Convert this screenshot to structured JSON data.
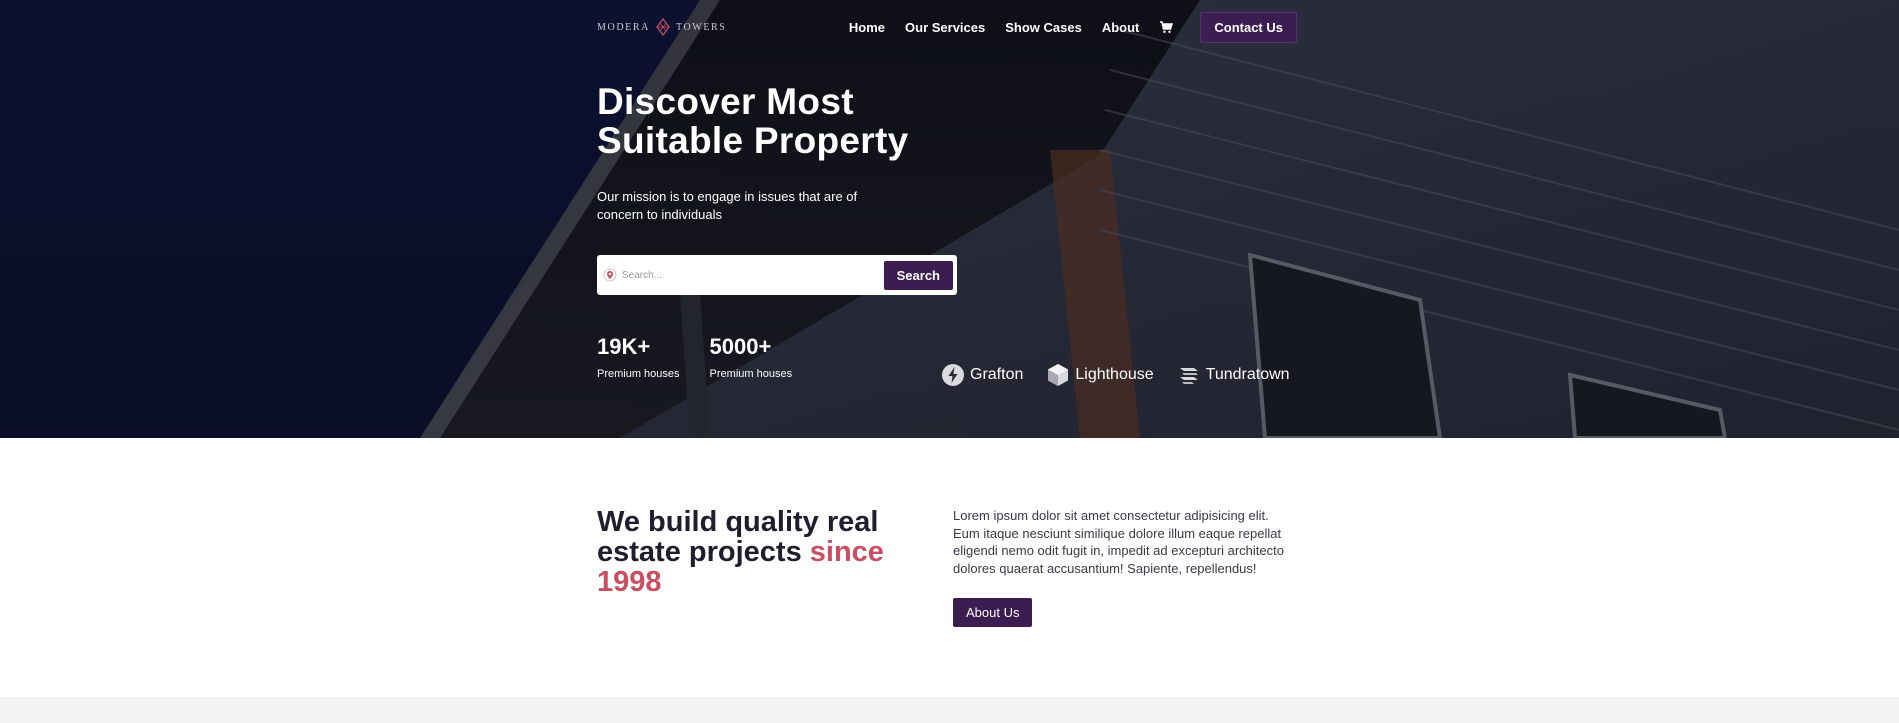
{
  "brand": {
    "logo_left": "MODERA",
    "logo_right": "TOWERS"
  },
  "nav": {
    "items": [
      {
        "label": "Home"
      },
      {
        "label": "Our Services"
      },
      {
        "label": "Show Cases"
      },
      {
        "label": "About"
      }
    ],
    "cart_icon": "cart-icon",
    "contact_label": "Contact Us"
  },
  "hero": {
    "title": "Discover Most Suitable Property",
    "subtitle": "Our mission is to engage in issues that are of concern to individuals",
    "search": {
      "placeholder": "Search...",
      "button_label": "Search",
      "icon": "location-pin-icon"
    },
    "stats": [
      {
        "value": "19K+",
        "label": "Premium houses"
      },
      {
        "value": "5000+",
        "label": "Premium houses"
      }
    ],
    "partners": [
      {
        "name": "Grafton",
        "icon": "bolt-icon"
      },
      {
        "name": "Lighthouse",
        "icon": "cube-icon"
      },
      {
        "name": "Tundratown",
        "icon": "layers-icon"
      }
    ]
  },
  "about": {
    "title_main": "We build quality real estate projects ",
    "title_accent": "since 1998",
    "body": "Lorem ipsum dolor sit amet consectetur adipisicing elit. Eum itaque nesciunt similique dolore illum eaque repellat eligendi nemo odit fugit in, impedit ad excepturi architecto dolores quaerat accusantium! Sapiente, repellendus!",
    "button_label": "About Us"
  },
  "colors": {
    "primary": "#3b1d52",
    "accent": "#c94f63",
    "hero_bg": "#0d1130"
  }
}
